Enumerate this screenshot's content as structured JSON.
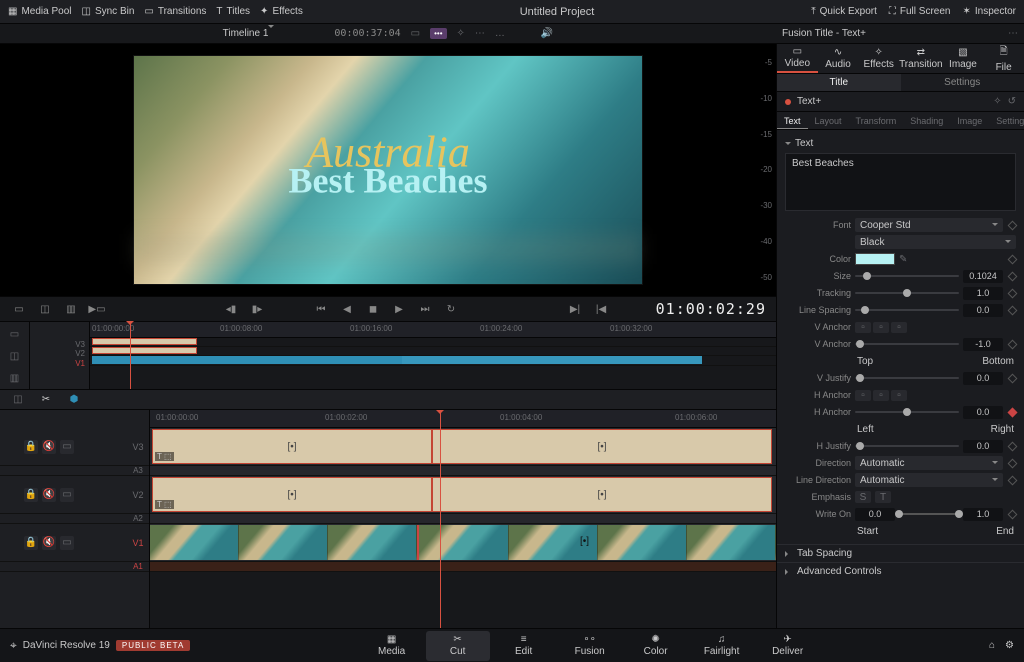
{
  "project_title": "Untitled Project",
  "topbar": {
    "media_pool": "Media Pool",
    "sync_bin": "Sync Bin",
    "transitions": "Transitions",
    "titles": "Titles",
    "effects": "Effects",
    "quick_export": "Quick Export",
    "full_screen": "Full Screen",
    "inspector": "Inspector"
  },
  "secbar": {
    "timeline": "Timeline 1",
    "tc": "00:00:37:04",
    "inspector_title": "Fusion Title - Text+"
  },
  "preview": {
    "line1": "Australia",
    "line2": "Best Beaches"
  },
  "vscale": [
    "-5",
    "-10",
    "-15",
    "-20",
    "-30",
    "-40",
    "-50"
  ],
  "transport_tc": "01:00:02:29",
  "inspector": {
    "tabs": [
      "Video",
      "Audio",
      "Effects",
      "Transition",
      "Image",
      "File"
    ],
    "seg": [
      "Title",
      "Settings"
    ],
    "head": "Text+",
    "subtabs": [
      "Text",
      "Layout",
      "Transform",
      "Shading",
      "Image",
      "Settings"
    ],
    "section": "Text",
    "text_value": "Best Beaches",
    "font_label": "Font",
    "font": "Cooper Std",
    "font_style": "Black",
    "color_label": "Color",
    "size_label": "Size",
    "size": "0.1024",
    "tracking_label": "Tracking",
    "tracking": "1.0",
    "linespacing_label": "Line Spacing",
    "linespacing": "0.0",
    "vanchor_label": "V Anchor",
    "vanchor": "-1.0",
    "vanchor_top": "Top",
    "vanchor_bot": "Bottom",
    "vjust_label": "V Justify",
    "vjust": "0.0",
    "hanchor_label": "H Anchor",
    "hanchor": "0.0",
    "hanchor_l": "Left",
    "hanchor_r": "Right",
    "hjust_label": "H Justify",
    "hjust": "0.0",
    "direction_label": "Direction",
    "direction": "Automatic",
    "linedir_label": "Line Direction",
    "linedir": "Automatic",
    "emphasis_label": "Emphasis",
    "writeon_label": "Write On",
    "writeon_a": "0.0",
    "writeon_b": "1.0",
    "writeon_sl": "Start",
    "writeon_el": "End",
    "coll1": "Tab Spacing",
    "coll2": "Advanced Controls"
  },
  "upper_ruler": [
    "01:00:00:00",
    "01:00:08:00",
    "01:00:16:00",
    "01:00:24:00",
    "01:00:32:00"
  ],
  "upper_tracks": [
    "V3",
    "V2",
    "V1"
  ],
  "lower_ruler": [
    "01:00:00:00",
    "01:00:02:00",
    "01:00:04:00",
    "01:00:06:00"
  ],
  "lower_tracks": {
    "v3": "V3",
    "a3": "A3",
    "v2": "V2",
    "a2": "A2",
    "v1": "V1",
    "a1": "A1"
  },
  "clip_tag": "T ⬚",
  "pages": {
    "media": "Media",
    "cut": "Cut",
    "edit": "Edit",
    "fusion": "Fusion",
    "color": "Color",
    "fairlight": "Fairlight",
    "deliver": "Deliver"
  },
  "brand": "DaVinci Resolve 19",
  "beta": "PUBLIC BETA"
}
